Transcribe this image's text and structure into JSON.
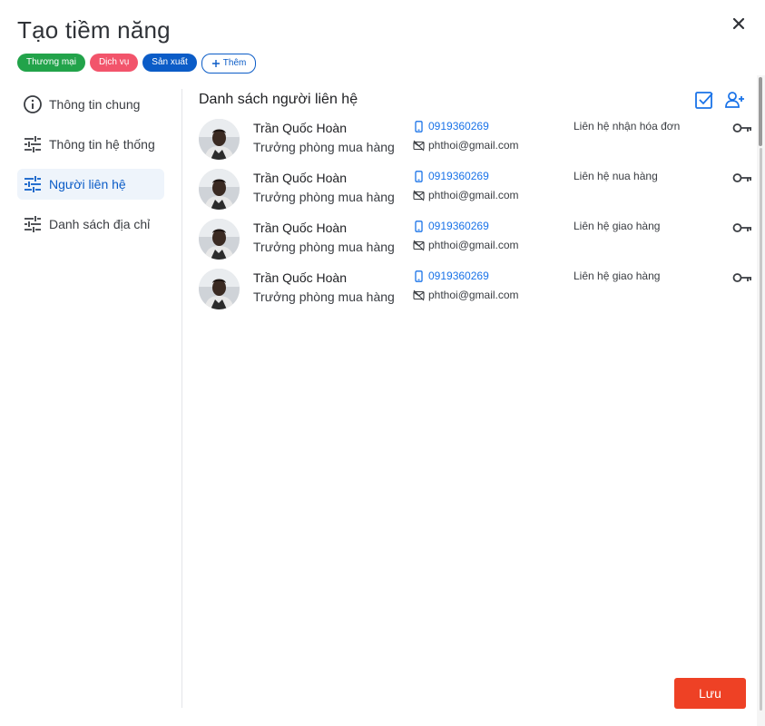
{
  "dialog": {
    "title": "Tạo tiềm năng"
  },
  "tags": [
    {
      "label": "Thương mại",
      "color": "#22a34a"
    },
    {
      "label": "Dịch vụ",
      "color": "#f2546b"
    },
    {
      "label": "Sản xuất",
      "color": "#0b5cc7"
    }
  ],
  "add_tag_label": "Thêm",
  "sidebar": {
    "items": [
      {
        "label": "Thông tin chung",
        "icon": "info-icon"
      },
      {
        "label": "Thông tin hệ thống",
        "icon": "sliders-icon"
      },
      {
        "label": "Người liên hệ",
        "icon": "sliders-icon",
        "active": true
      },
      {
        "label": "Danh sách địa chỉ",
        "icon": "sliders-icon"
      }
    ]
  },
  "section": {
    "title": "Danh sách người liên hệ"
  },
  "contacts": [
    {
      "name": "Trần Quốc Hoàn",
      "role": "Trưởng phòng mua hàng",
      "phone": "0919360269",
      "email": "phthoi@gmail.com",
      "type": "Liên hệ nhận hóa đơn"
    },
    {
      "name": "Trần Quốc Hoàn",
      "role": "Trưởng phòng mua hàng",
      "phone": "0919360269",
      "email": "phthoi@gmail.com",
      "type": "Liên hệ nua hàng"
    },
    {
      "name": "Trần Quốc Hoàn",
      "role": "Trưởng phòng mua hàng",
      "phone": "0919360269",
      "email": "phthoi@gmail.com",
      "type": "Liên hệ giao hàng"
    },
    {
      "name": "Trần Quốc Hoàn",
      "role": "Trưởng phòng mua hàng",
      "phone": "0919360269",
      "email": "phthoi@gmail.com",
      "type": "Liên hệ giao hàng"
    }
  ],
  "footer": {
    "save_label": "Lưu"
  },
  "colors": {
    "primary": "#0b5cc7",
    "link": "#1a73e8",
    "save": "#ee4125"
  }
}
